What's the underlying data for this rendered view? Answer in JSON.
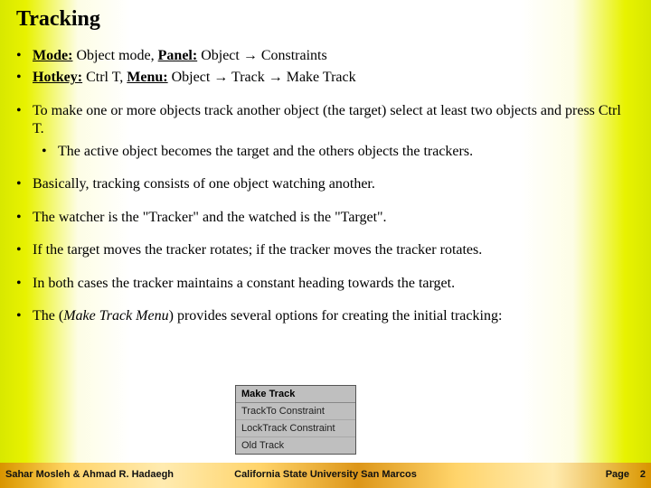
{
  "title": "Tracking",
  "lines": {
    "mode_label": "Mode:",
    "mode_value": " Object mode, ",
    "panel_label": "Panel:",
    "panel_value": " Object → Constraints",
    "hotkey_label": "Hotkey:",
    "hotkey_value": " Ctrl T, ",
    "menu_label": "Menu:",
    "menu_value": " Object → Track → Make Track",
    "para1": "To make one or more objects track another object (the target) select at least two objects and press Ctrl T.",
    "para1_sub": "The active object becomes the target and the others objects the trackers.",
    "para2": "Basically, tracking consists of one object watching another.",
    "para3": "The watcher is the \"Tracker\" and the watched is the \"Target\".",
    "para4": "If the target moves the tracker rotates; if the tracker moves the tracker rotates.",
    "para5": "In both cases the tracker maintains a constant heading towards the target.",
    "para6_pre": "The (",
    "para6_em": "Make Track Menu",
    "para6_post": ") provides several options for creating the initial tracking:"
  },
  "menu": {
    "header": "Make Track",
    "items": [
      "TrackTo Constraint",
      "LockTrack Constraint",
      "Old Track"
    ]
  },
  "footer": {
    "left": "Sahar Mosleh & Ahmad R. Hadaegh",
    "center": "California State University San Marcos",
    "right": "Page",
    "page_number": "2"
  }
}
